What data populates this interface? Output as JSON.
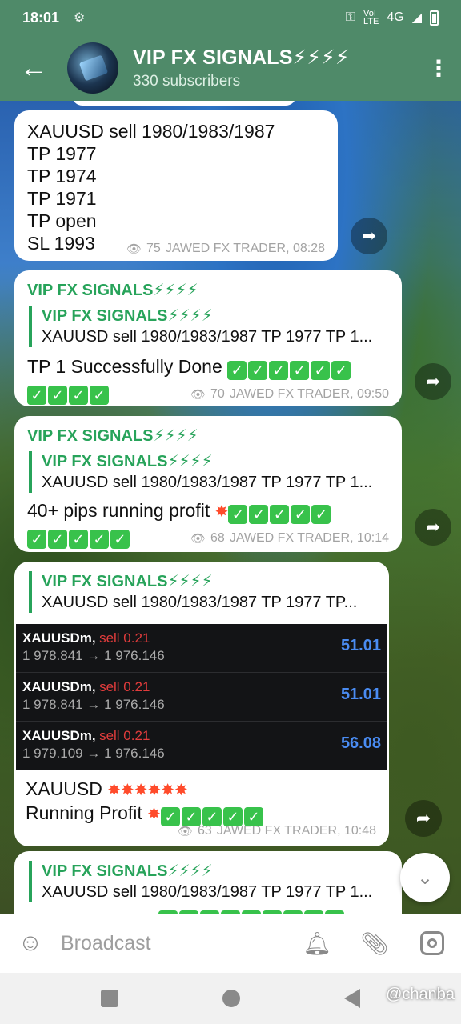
{
  "status": {
    "time": "18:01",
    "network": "4G"
  },
  "header": {
    "title": "VIP FX SIGNALS⚡⚡⚡⚡",
    "subtitle": "330 subscribers"
  },
  "messages": [
    {
      "lines": [
        "XAUUSD sell 1980/1983/1987",
        "TP 1977",
        "TP 1974",
        "TP 1971",
        "TP open",
        "SL 1993"
      ],
      "views": "75",
      "author_time": "JAWED FX TRADER, 08:28"
    },
    {
      "channel": "VIP FX SIGNALS⚡⚡⚡⚡",
      "reply_title": "VIP FX SIGNALS⚡⚡⚡⚡",
      "reply_text": "XAUUSD sell 1980/1983/1987 TP 1977 TP 1...",
      "text": "TP 1 Successfully Done",
      "checks_line1": 6,
      "checks_line2": 4,
      "views": "70",
      "author_time": "JAWED FX TRADER, 09:50"
    },
    {
      "channel": "VIP FX SIGNALS⚡⚡⚡⚡",
      "reply_title": "VIP FX SIGNALS⚡⚡⚡⚡",
      "reply_text": "XAUUSD sell 1980/1983/1987 TP 1977 TP 1...",
      "text": "40+ pips running profit",
      "checks_line1": 5,
      "checks_line2": 5,
      "views": "68",
      "author_time": "JAWED FX TRADER, 10:14"
    },
    {
      "reply_title": "VIP FX SIGNALS⚡⚡⚡⚡",
      "reply_text": "XAUUSD sell 1980/1983/1987 TP 1977 TP...",
      "trades": [
        {
          "symbol": "XAUUSDm,",
          "side": "sell 0.21",
          "prices": "1 978.841 → 1 976.146",
          "profit": "51.01"
        },
        {
          "symbol": "XAUUSDm,",
          "side": "sell 0.21",
          "prices": "1 978.841 → 1 976.146",
          "profit": "51.01"
        },
        {
          "symbol": "XAUUSDm,",
          "side": "sell 0.21",
          "prices": "1 979.109 → 1 976.146",
          "profit": "56.08"
        }
      ],
      "line1": "XAUUSD",
      "line2": "Running Profit",
      "views": "63",
      "author_time": "JAWED FX TRADER, 10:48"
    },
    {
      "reply_title": "VIP FX SIGNALS⚡⚡⚡⚡",
      "reply_text": "XAUUSD sell 1980/1983/1987 TP 1977 TP 1..."
    }
  ],
  "composer": {
    "placeholder": "Broadcast"
  },
  "watermark": "@chanba"
}
